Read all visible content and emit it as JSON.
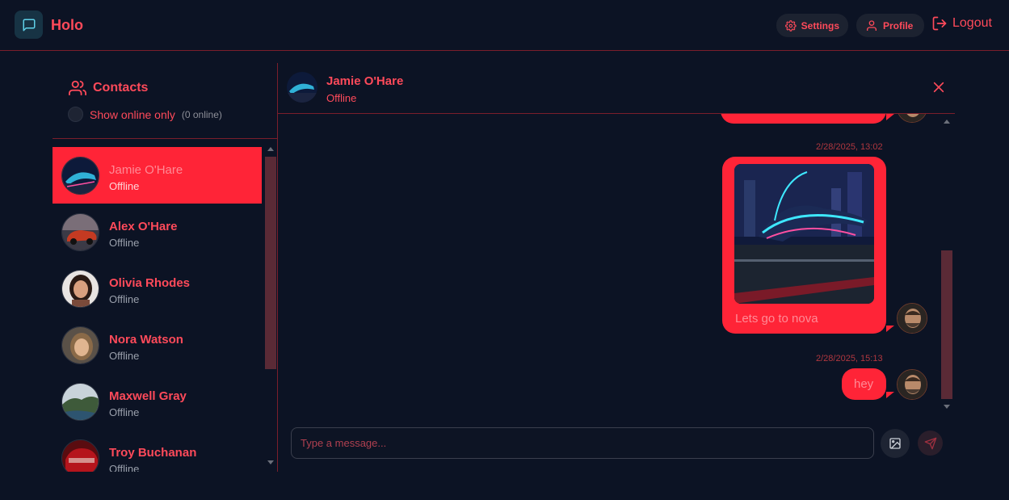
{
  "app": {
    "brand": "Holo"
  },
  "header": {
    "settings_label": "Settings",
    "profile_label": "Profile",
    "logout_label": "Logout"
  },
  "sidebar": {
    "title": "Contacts",
    "online_toggle_label": "Show online only",
    "online_count": "(0 online)",
    "contacts": [
      {
        "name": "Jamie O'Hare",
        "status": "Offline",
        "active": true
      },
      {
        "name": "Alex O'Hare",
        "status": "Offline"
      },
      {
        "name": "Olivia Rhodes",
        "status": "Offline"
      },
      {
        "name": "Nora Watson",
        "status": "Offline"
      },
      {
        "name": "Maxwell Gray",
        "status": "Offline"
      },
      {
        "name": "Troy Buchanan",
        "status": "Offline"
      }
    ]
  },
  "chat": {
    "contact_name": "Jamie O'Hare",
    "contact_status": "Offline",
    "messages": [
      {
        "timestamp": "2/28/2025, 13:02",
        "text": "Lets go to nova",
        "has_image": true
      },
      {
        "timestamp": "2/28/2025, 15:13",
        "text": "hey"
      }
    ],
    "composer_placeholder": "Type a message..."
  },
  "colors": {
    "accent": "#ff2437",
    "background": "#0c1324",
    "text_accent": "#ff4a5a"
  }
}
